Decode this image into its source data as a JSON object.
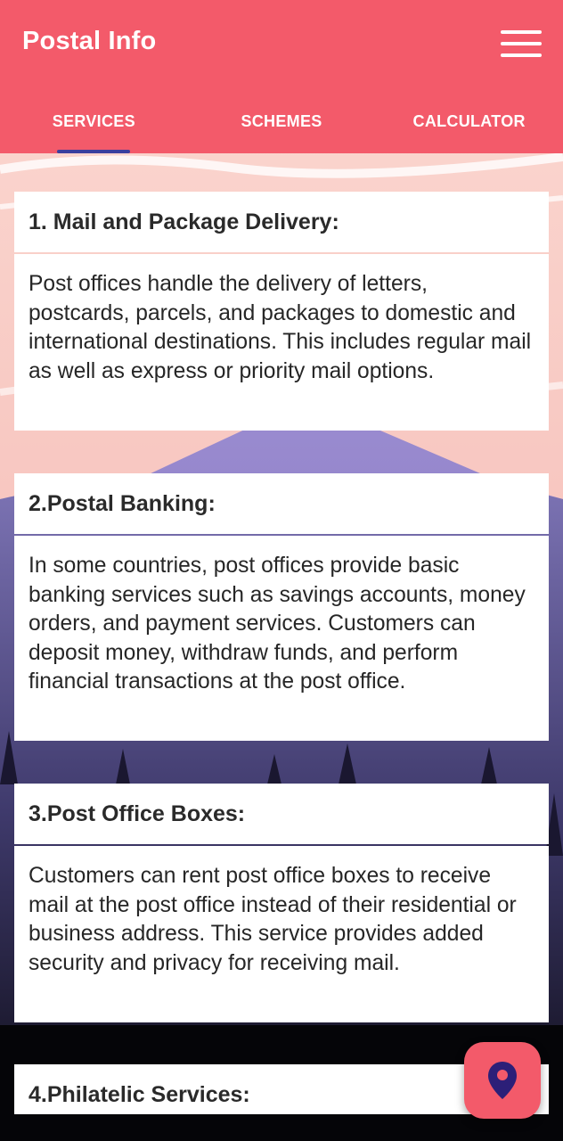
{
  "app": {
    "title": "Postal Info",
    "accent_color": "#f35a6a",
    "indicator_color": "#3a3f9e"
  },
  "tabs": [
    {
      "label": "SERVICES",
      "selected": true
    },
    {
      "label": "SCHEMES",
      "selected": false
    },
    {
      "label": "CALCULATOR",
      "selected": false
    }
  ],
  "services": [
    {
      "heading": "1. Mail and Package Delivery:",
      "body": "Post offices handle the delivery of letters, postcards, parcels, and packages to domestic and international destinations. This includes regular mail as well as express or priority mail options."
    },
    {
      "heading": "2.Postal Banking:",
      "body": "In some countries, post offices provide basic banking services such as savings accounts, money orders, and payment services. Customers can deposit money, withdraw funds, and perform financial transactions at the post office."
    },
    {
      "heading": "3.Post Office Boxes:",
      "body": "Customers can rent post office boxes to receive mail at the post office instead of their residential or business address. This service provides added security and privacy for receiving mail."
    },
    {
      "heading": "4.Philatelic Services:",
      "body": ""
    }
  ],
  "icons": {
    "menu": "hamburger-menu-icon",
    "fab": "location-pin-icon"
  }
}
